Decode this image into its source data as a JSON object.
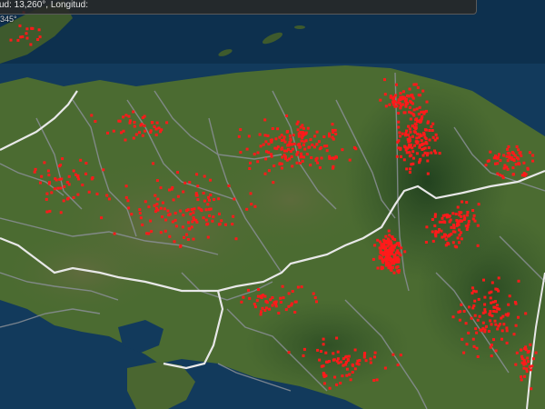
{
  "coordinate_readout": {
    "line1": "ud: 13,260°, Longitud:",
    "line2": "345°"
  },
  "map": {
    "basemap": "satellite-imagery",
    "layers": [
      "country-borders",
      "department-borders",
      "fire-hotspots"
    ],
    "colors": {
      "ocean": "#0f3557",
      "land": "#4a6a30",
      "hotspot": "#ff1a1a",
      "country_border": "#e6e6e6",
      "department_border": "#8a8f96"
    }
  }
}
